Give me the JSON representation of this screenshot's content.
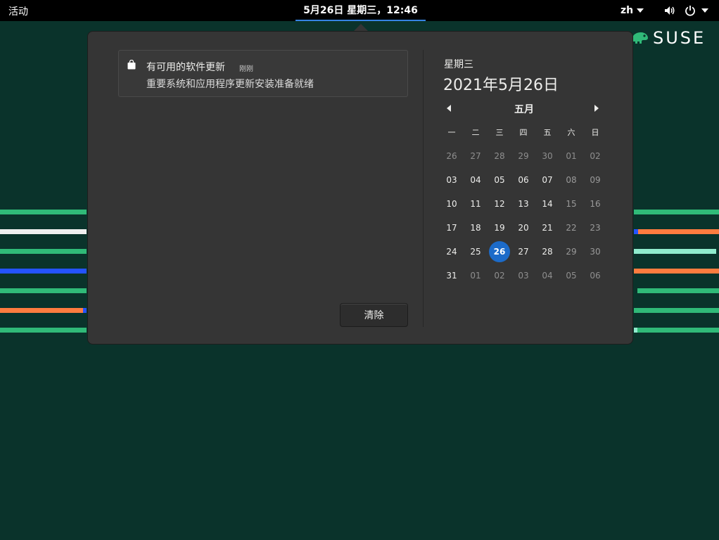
{
  "topbar": {
    "activities": "活动",
    "clock": "5月26日 星期三，12:46",
    "language": "zh"
  },
  "brand": {
    "logo_text": "SUSE",
    "accent": "#30ba78"
  },
  "notification": {
    "title": "有可用的软件更新",
    "time": "刚刚",
    "body": "重要系统和应用程序更新安装准备就绪",
    "icon": "shopping-bag-icon"
  },
  "clear_label": "清除",
  "calendar": {
    "weekday": "星期三",
    "date": "2021年5月26日",
    "month": "五月",
    "dow": [
      "一",
      "二",
      "三",
      "四",
      "五",
      "六",
      "日"
    ],
    "weeks": [
      [
        {
          "d": "26",
          "o": 1
        },
        {
          "d": "27",
          "o": 1
        },
        {
          "d": "28",
          "o": 1
        },
        {
          "d": "29",
          "o": 1
        },
        {
          "d": "30",
          "o": 1
        },
        {
          "d": "01",
          "o": 2
        },
        {
          "d": "02",
          "o": 2
        }
      ],
      [
        {
          "d": "03"
        },
        {
          "d": "04"
        },
        {
          "d": "05"
        },
        {
          "d": "06"
        },
        {
          "d": "07"
        },
        {
          "d": "08",
          "w": 1
        },
        {
          "d": "09",
          "w": 1
        }
      ],
      [
        {
          "d": "10"
        },
        {
          "d": "11"
        },
        {
          "d": "12"
        },
        {
          "d": "13"
        },
        {
          "d": "14"
        },
        {
          "d": "15",
          "w": 1
        },
        {
          "d": "16",
          "w": 1
        }
      ],
      [
        {
          "d": "17"
        },
        {
          "d": "18"
        },
        {
          "d": "19"
        },
        {
          "d": "20"
        },
        {
          "d": "21"
        },
        {
          "d": "22",
          "w": 1
        },
        {
          "d": "23",
          "w": 1
        }
      ],
      [
        {
          "d": "24"
        },
        {
          "d": "25"
        },
        {
          "d": "26",
          "t": 1
        },
        {
          "d": "27"
        },
        {
          "d": "28"
        },
        {
          "d": "29",
          "w": 1
        },
        {
          "d": "30",
          "w": 1
        }
      ],
      [
        {
          "d": "31"
        },
        {
          "d": "01",
          "o": 1
        },
        {
          "d": "02",
          "o": 1
        },
        {
          "d": "03",
          "o": 1
        },
        {
          "d": "04",
          "o": 1
        },
        {
          "d": "05",
          "o": 1
        },
        {
          "d": "06",
          "o": 1
        }
      ]
    ]
  },
  "colors": {
    "desktop_bg": "#0a332b",
    "popover_bg": "#353535",
    "today": "#1c6bc9",
    "stripe_green": "#30ba78",
    "stripe_orange": "#fe7c3f",
    "stripe_blue": "#2453ff",
    "stripe_mint": "#90ebcd",
    "stripe_white": "#efefef"
  }
}
